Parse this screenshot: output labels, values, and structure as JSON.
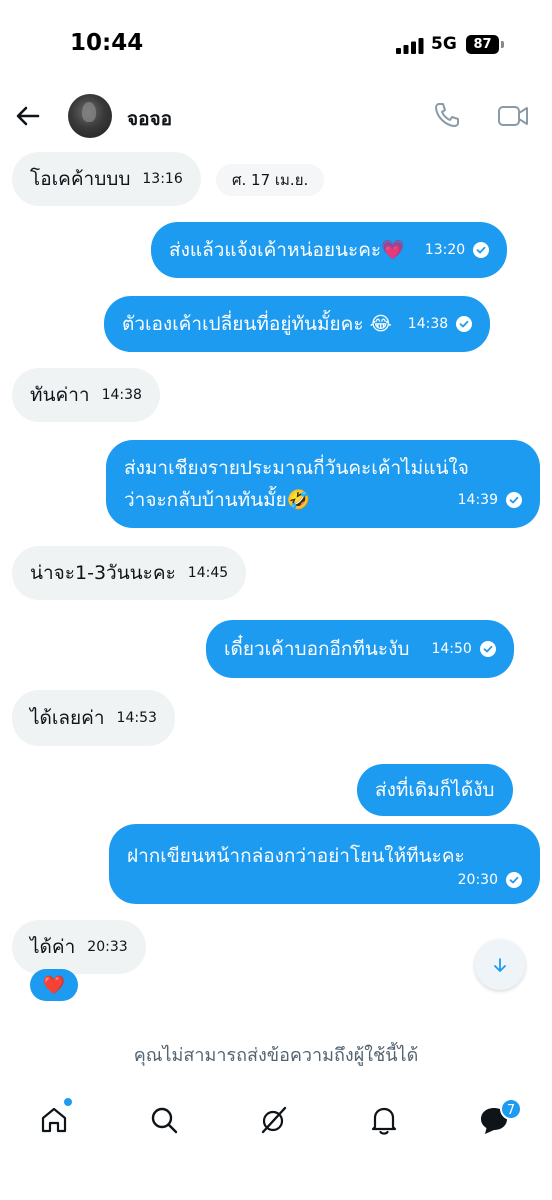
{
  "status_bar": {
    "time": "10:44",
    "network": "5G",
    "battery": "87"
  },
  "header": {
    "contact_name": "จอจอ"
  },
  "date_chip": "ศ. 17 เม.ย.",
  "messages": [
    {
      "dir": "in",
      "text": "โอเคค้าบบบ",
      "time": "13:16"
    },
    {
      "dir": "out",
      "text": "ส่งแล้วแจ้งเค้าหน่อยนะคะ💗",
      "time": "13:20"
    },
    {
      "dir": "out",
      "text": "ตัวเองเค้าเปลี่ยนที่อยู่ทันมั้ยคะ 😂",
      "time": "14:38"
    },
    {
      "dir": "in",
      "text": "ทันค่าา",
      "time": "14:38"
    },
    {
      "dir": "out",
      "line1": "ส่งมาเชียงรายประมาณกี่วันคะเค้าไม่แน่ใจ",
      "line2": "ว่าจะกลับบ้านทันมั้ย🤣",
      "time": "14:39"
    },
    {
      "dir": "in",
      "text": "น่าจะ1-3วันนะคะ",
      "time": "14:45"
    },
    {
      "dir": "out",
      "text": "เดี๋ยวเค้าบอกอีกทีนะงับ",
      "time": "14:50"
    },
    {
      "dir": "in",
      "text": "ได้เลยค่า",
      "time": "14:53"
    },
    {
      "dir": "out",
      "text": "ส่งที่เดิมก็ได้งับ"
    },
    {
      "dir": "out",
      "line1": "ฝากเขียนหน้ากล่องกว่าอย่าโยนให้ทีนะคะ",
      "time": "20:30"
    },
    {
      "dir": "in",
      "text": "ได้ค่า",
      "time": "20:33",
      "reaction": "❤️"
    }
  ],
  "notice": "คุณไม่สามารถส่งข้อความถึงผู้ใช้นี้ได้",
  "bottom_nav": {
    "items": [
      "home-icon",
      "search-icon",
      "grok-icon",
      "bell-icon",
      "messages-icon"
    ],
    "messages_badge": "7"
  },
  "colors": {
    "accent": "#1d9bf0",
    "incoming_bubble": "#eff3f4",
    "text": "#0f1419",
    "muted": "#536471"
  },
  "icons": {
    "back": "arrow-left-icon",
    "call": "phone-icon",
    "video": "video-icon",
    "scroll": "arrow-down-icon"
  }
}
